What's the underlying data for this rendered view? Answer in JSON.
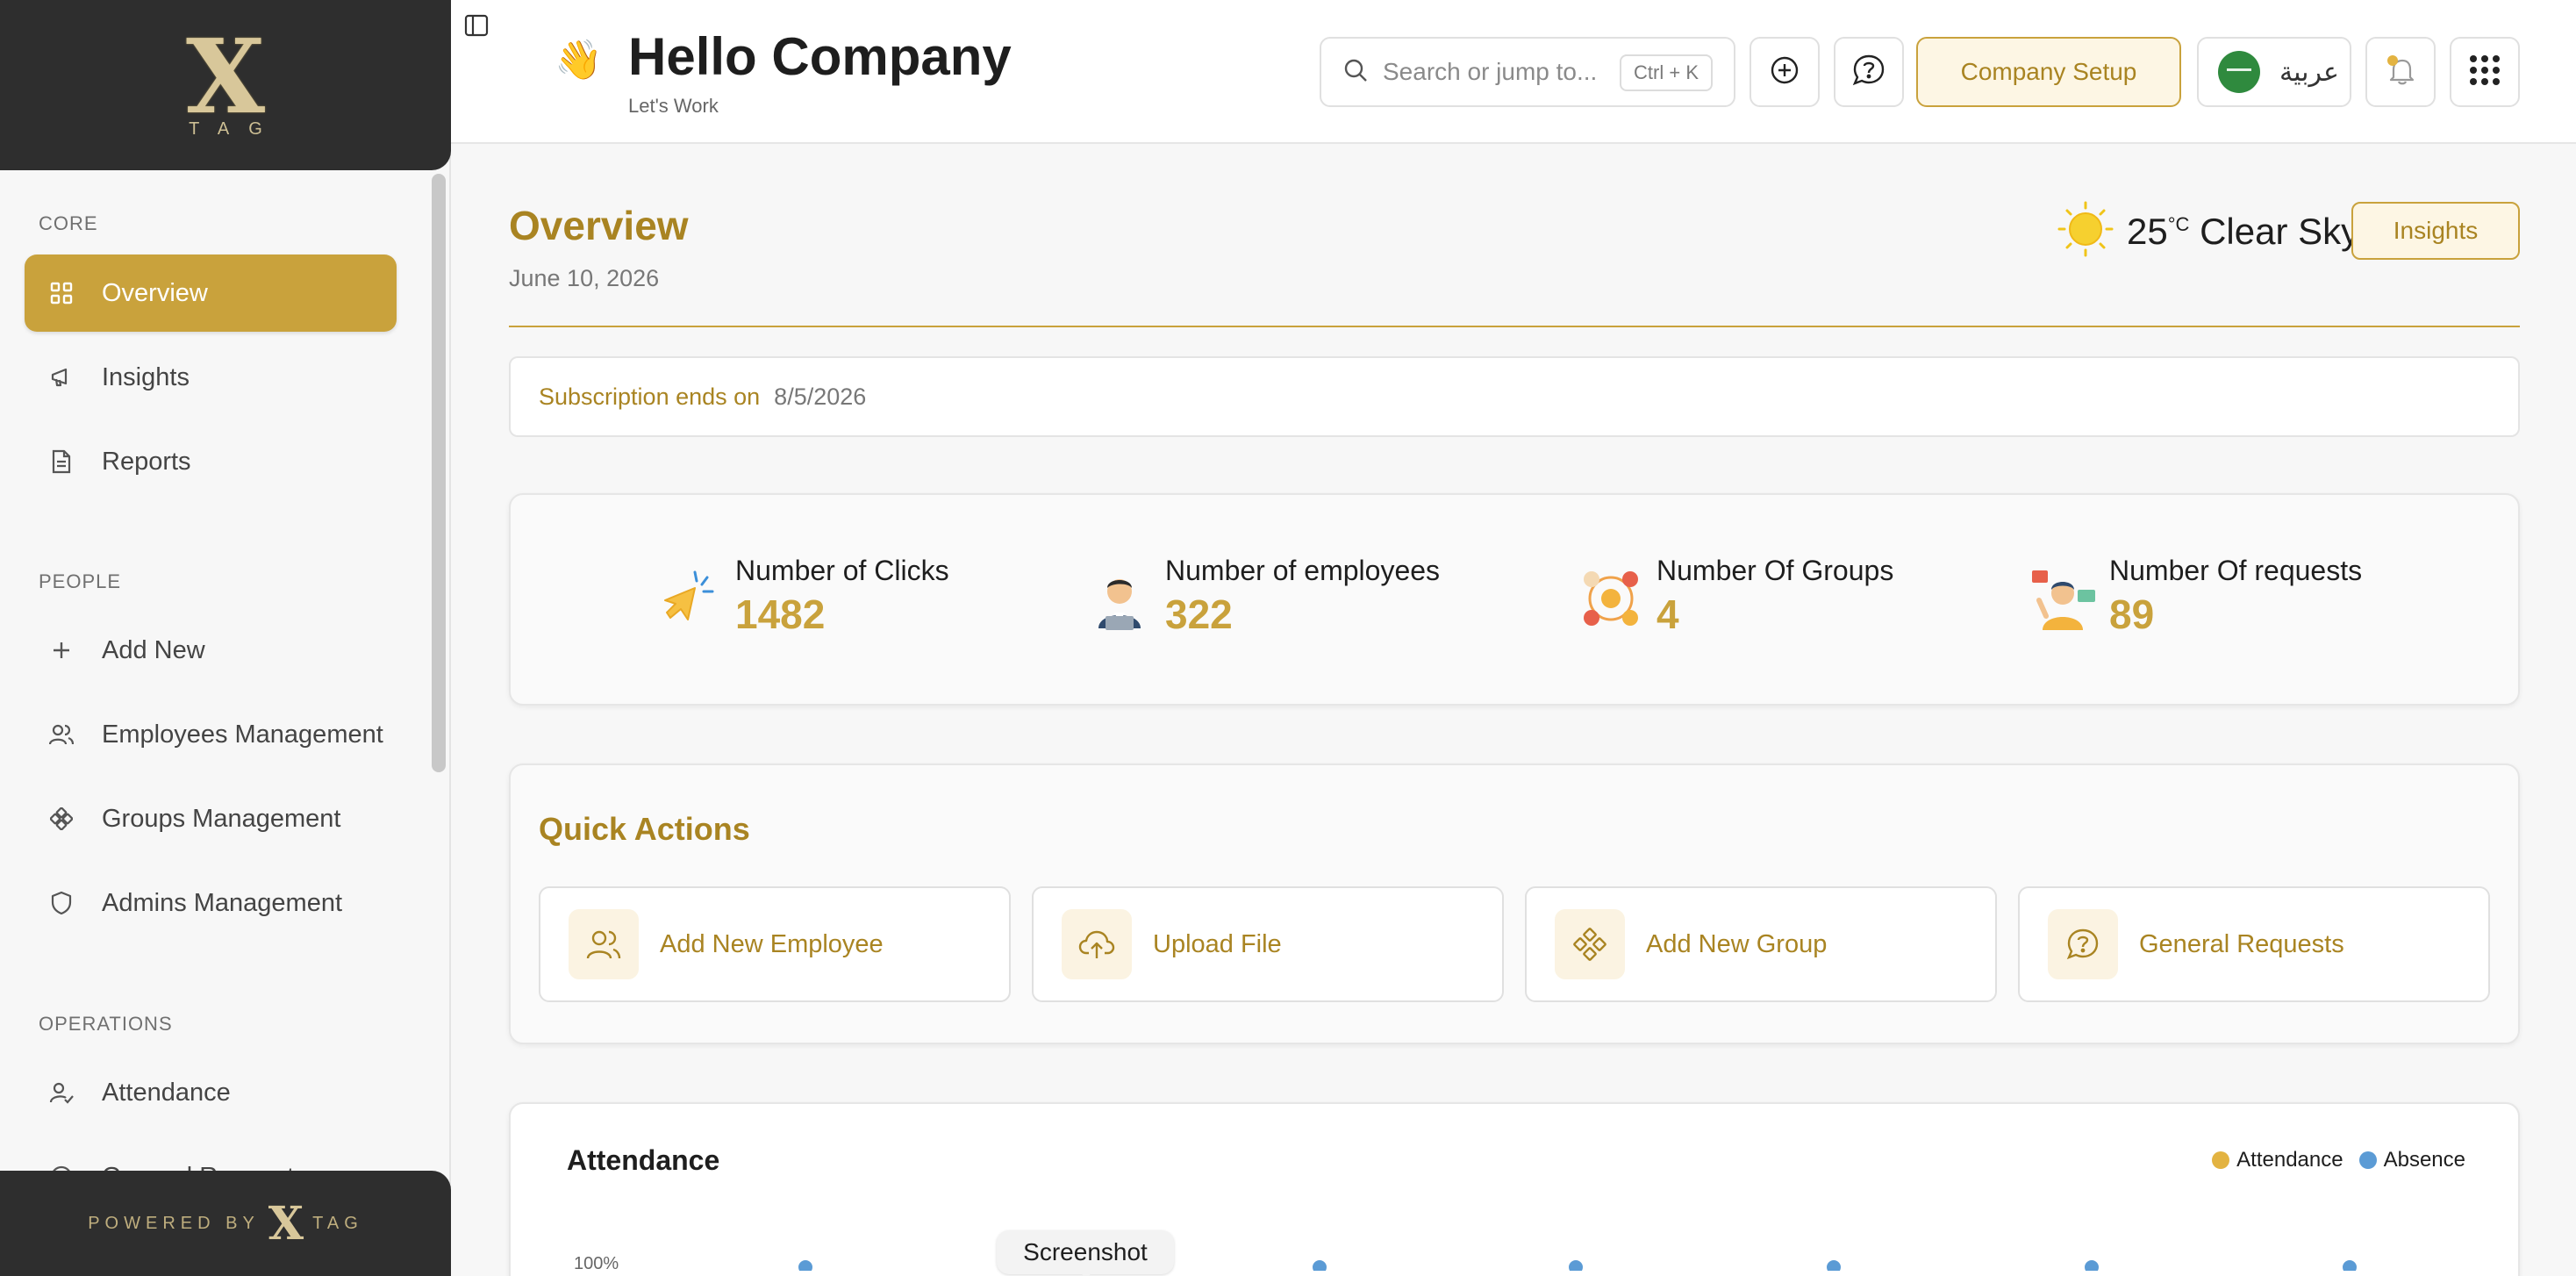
{
  "brand": {
    "logo_mark": "X",
    "logo_word": "TAG",
    "powered_by": "POWERED BY",
    "powered_mark": "X",
    "powered_word": "TAG"
  },
  "sidebar": {
    "sections": [
      {
        "label": "CORE"
      },
      {
        "label": "PEOPLE"
      },
      {
        "label": "OPERATIONS"
      }
    ],
    "items": [
      {
        "label": "Overview",
        "icon": "grid-icon"
      },
      {
        "label": "Insights",
        "icon": "megaphone-icon"
      },
      {
        "label": "Reports",
        "icon": "document-icon"
      },
      {
        "label": "Add New",
        "icon": "plus-icon"
      },
      {
        "label": "Employees Management",
        "icon": "users-icon"
      },
      {
        "label": "Groups Management",
        "icon": "groups-icon"
      },
      {
        "label": "Admins Management",
        "icon": "shield-icon"
      },
      {
        "label": "Attendance",
        "icon": "user-check-icon"
      },
      {
        "label": "General Requests",
        "icon": "help-circle-icon"
      }
    ]
  },
  "header": {
    "greeting_emoji": "👋",
    "title": "Hello Company",
    "subtitle": "Let's Work",
    "search_placeholder": "Search or jump to...",
    "search_shortcut": "Ctrl + K",
    "company_setup": "Company Setup",
    "language": "عربية"
  },
  "overview": {
    "title": "Overview",
    "date": "June 10, 2026",
    "temperature": "25",
    "temp_unit": "°C",
    "weather": "Clear Sky",
    "insights_button": "Insights"
  },
  "subscription": {
    "label": "Subscription ends on",
    "date": "8/5/2026"
  },
  "stats": [
    {
      "label": "Number of Clicks",
      "value": "1482"
    },
    {
      "label": "Number of employees",
      "value": "322"
    },
    {
      "label": "Number Of Groups",
      "value": "4"
    },
    {
      "label": "Number Of requests",
      "value": "89"
    }
  ],
  "quick_actions": {
    "title": "Quick Actions",
    "items": [
      {
        "label": "Add New Employee",
        "icon": "users-icon"
      },
      {
        "label": "Upload File",
        "icon": "cloud-upload-icon"
      },
      {
        "label": "Add New Group",
        "icon": "groups-icon"
      },
      {
        "label": "General Requests",
        "icon": "help-circle-icon"
      }
    ]
  },
  "attendance": {
    "title": "Attendance",
    "legend": [
      {
        "name": "Attendance",
        "color": "#e3b341"
      },
      {
        "name": "Absence",
        "color": "#5b9bd5"
      }
    ],
    "y_top_label": "100%"
  },
  "tooltip": "Screenshot",
  "colors": {
    "accent": "#c9a23c",
    "accent_text": "#a98422",
    "dark": "#2e2e2e"
  }
}
